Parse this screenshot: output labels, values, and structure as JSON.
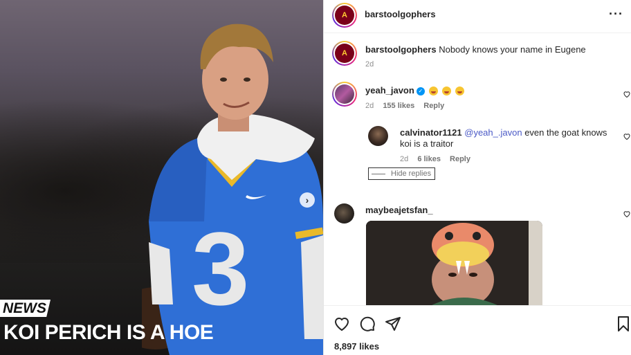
{
  "post": {
    "media": {
      "tag": "NEWS",
      "headline": "KOI PERICH IS A HOE",
      "jersey_number": "3",
      "next_icon": "chevron-right-icon"
    },
    "author": "barstoolgophers",
    "author_logo_text": "A"
  },
  "caption": {
    "username": "barstoolgophers",
    "text": "Nobody knows your name in Eugene",
    "time": "2d"
  },
  "comments": [
    {
      "username": "yeah_javon",
      "verified": true,
      "time": "2d",
      "likes": "155 likes",
      "reply": "Reply"
    }
  ],
  "reply": {
    "username": "calvinator1121",
    "mention": "@yeah_.javon",
    "text": "even the goat knows koi is a traitor",
    "time": "2d",
    "likes": "6 likes",
    "reply": "Reply"
  },
  "hide_replies": "Hide replies",
  "comment2": {
    "username": "maybeajetsfan_"
  },
  "footer": {
    "likes": "8,897 likes",
    "icons": [
      "heart-icon",
      "comment-icon",
      "share-icon",
      "bookmark-icon"
    ]
  },
  "colors": {
    "mention": "#4a59c6",
    "verified": "#0095f6",
    "logo_bg": "#7a0019",
    "logo_fg": "#ffcc33"
  }
}
